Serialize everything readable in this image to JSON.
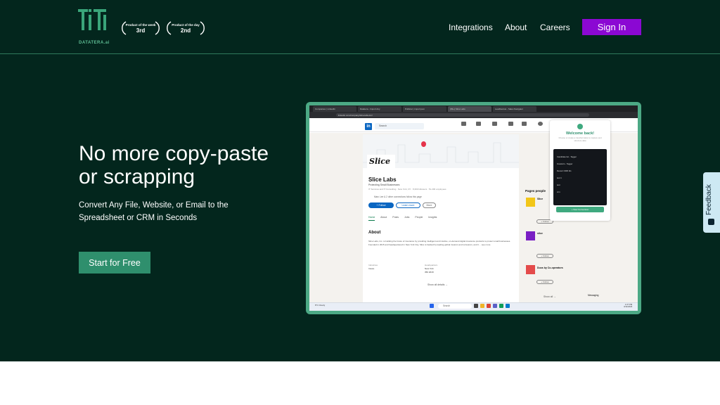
{
  "brand": {
    "logo_text": "DATATERA.ai"
  },
  "badges": [
    {
      "caption": "Product of the week",
      "rank": "3rd"
    },
    {
      "caption": "Product of the day",
      "rank": "2nd"
    }
  ],
  "nav": {
    "integrations": "Integrations",
    "about": "About",
    "careers": "Careers",
    "signin": "Sign In"
  },
  "hero": {
    "heading": "No more copy-paste or scrapping",
    "subheading": "Convert Any File, Website, or Email to the Spreadsheet or CRM in Seconds",
    "cta": "Start for Free"
  },
  "feedback": {
    "label": "Feedback"
  },
  "colors": {
    "hero_bg": "#03261d",
    "accent_green": "#2f8f6d",
    "signin_purple": "#8b08d3",
    "feedback_bg": "#cde9f3"
  },
  "embedded": {
    "tabs": [
      "Companies | LinkedIn",
      "Datatera - Import Any",
      "Publicar | import json",
      "(99+) Slice Labs",
      "LeadGenius - Sales Navigator"
    ],
    "address": "linkedin.com/company/slice-labs-inc/",
    "search_placeholder": "Search",
    "company": {
      "logo": "Slice",
      "name": "Slice Labs",
      "tagline": "Protecting Small Businesses",
      "meta": "IT Services and IT Consulting · New York, NY · 8,360 followers · 51-200 employees",
      "connections": "Marc Lee & 2 other connections follow this page",
      "follow": "+ Follow",
      "learn_more": "Learn more",
      "more": "More",
      "tabs": [
        "Home",
        "About",
        "Posts",
        "Jobs",
        "People",
        "Insights"
      ],
      "about_title": "About",
      "about_text": "Slice Labs, Inc. is building the future of insurance by providing intelligent and intuitive, on-demand digital insurance products to protect small businesses. Founded in 2015 and headquartered in New York City, Slice is backed by leading global insurers and reinsurers, and it ... see more",
      "detail_1_label": "Industries",
      "detail_1_value": "Insure",
      "detail_2_label": "Headquarters",
      "detail_2_value": "New York",
      "detail_3_value": "350 2018",
      "show_all": "Show all details →"
    },
    "pages_people": {
      "title": "Pages people",
      "items": [
        {
          "name": "Slice",
          "follow": "+ Follow"
        },
        {
          "name": "slice",
          "follow": "+ Follow"
        },
        {
          "name": "Duos by Co-operators",
          "follow": "+ Follow"
        }
      ],
      "show_all": "Show all →"
    },
    "popup": {
      "title": "Welcome back!",
      "subtitle": "Choose or create a transformation to capture and structure data",
      "items": [
        "Candidate list - Tagger",
        "Investors - Tagger",
        "Recent CRM Ids",
        "test 1",
        "test",
        "crm"
      ],
      "button": "+ New Conversion"
    },
    "taskbar": {
      "search": "Search",
      "time": "1:37 PM",
      "date": "4/11/2023",
      "weather": "8°C Cloudy"
    },
    "messaging": "Messaging"
  }
}
